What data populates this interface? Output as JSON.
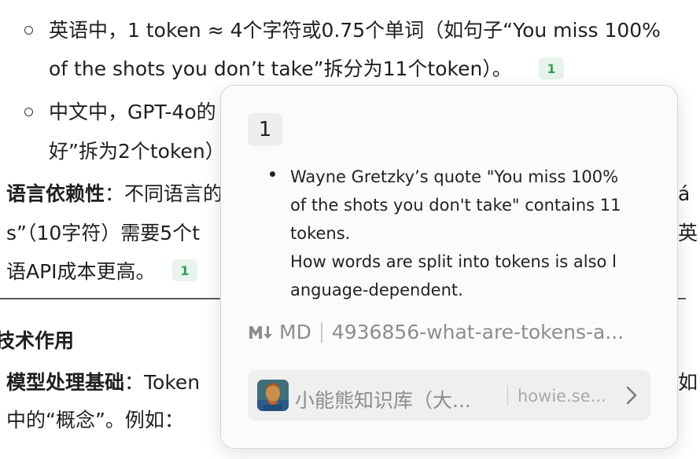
{
  "doc": {
    "bullet1": {
      "line1": "英语中，1 token ≈ 4个字符或0.75个单词（如句子“You miss 100%",
      "line2": "of the shots you don’t take”拆分为11个token）。"
    },
    "bullet2": {
      "line1": "中文中，GPT-4o的",
      "line2": "好”拆为2个token）"
    },
    "lang_dep": {
      "term": "语言依赖性",
      "colon_text": "：不同语言的",
      "right_fragment": "á",
      "line2_left": "s”（10字符）需要5个t",
      "line2_right": "英",
      "line3": "语API成本更高。"
    },
    "section_heading": "技术作用",
    "model_basis": {
      "term": "模型处理基础",
      "colon_text": "：Token",
      "right_fragment": "如",
      "line2": "中的“概念”。例如："
    },
    "citation_label": "1"
  },
  "popover": {
    "number": "1",
    "text": "Wayne Gretzky’s quote \"You miss 100%\nof the shots you don't take\" contains 11\ntokens.\nHow words are split into tokens is also l\nanguage-dependent.",
    "format_label": "MD",
    "file_name": "4936856-what-are-tokens-a...",
    "kb_name": "小能熊知识库（大...",
    "kb_url": "howie.se..."
  },
  "icons": {
    "md": "markdown-icon",
    "avatar": "kb-avatar",
    "chevron": "chevron-right-icon"
  },
  "colors": {
    "citation_bg": "#e8f3ec",
    "citation_fg": "#3a9a5c",
    "muted": "#8d8d8d"
  }
}
